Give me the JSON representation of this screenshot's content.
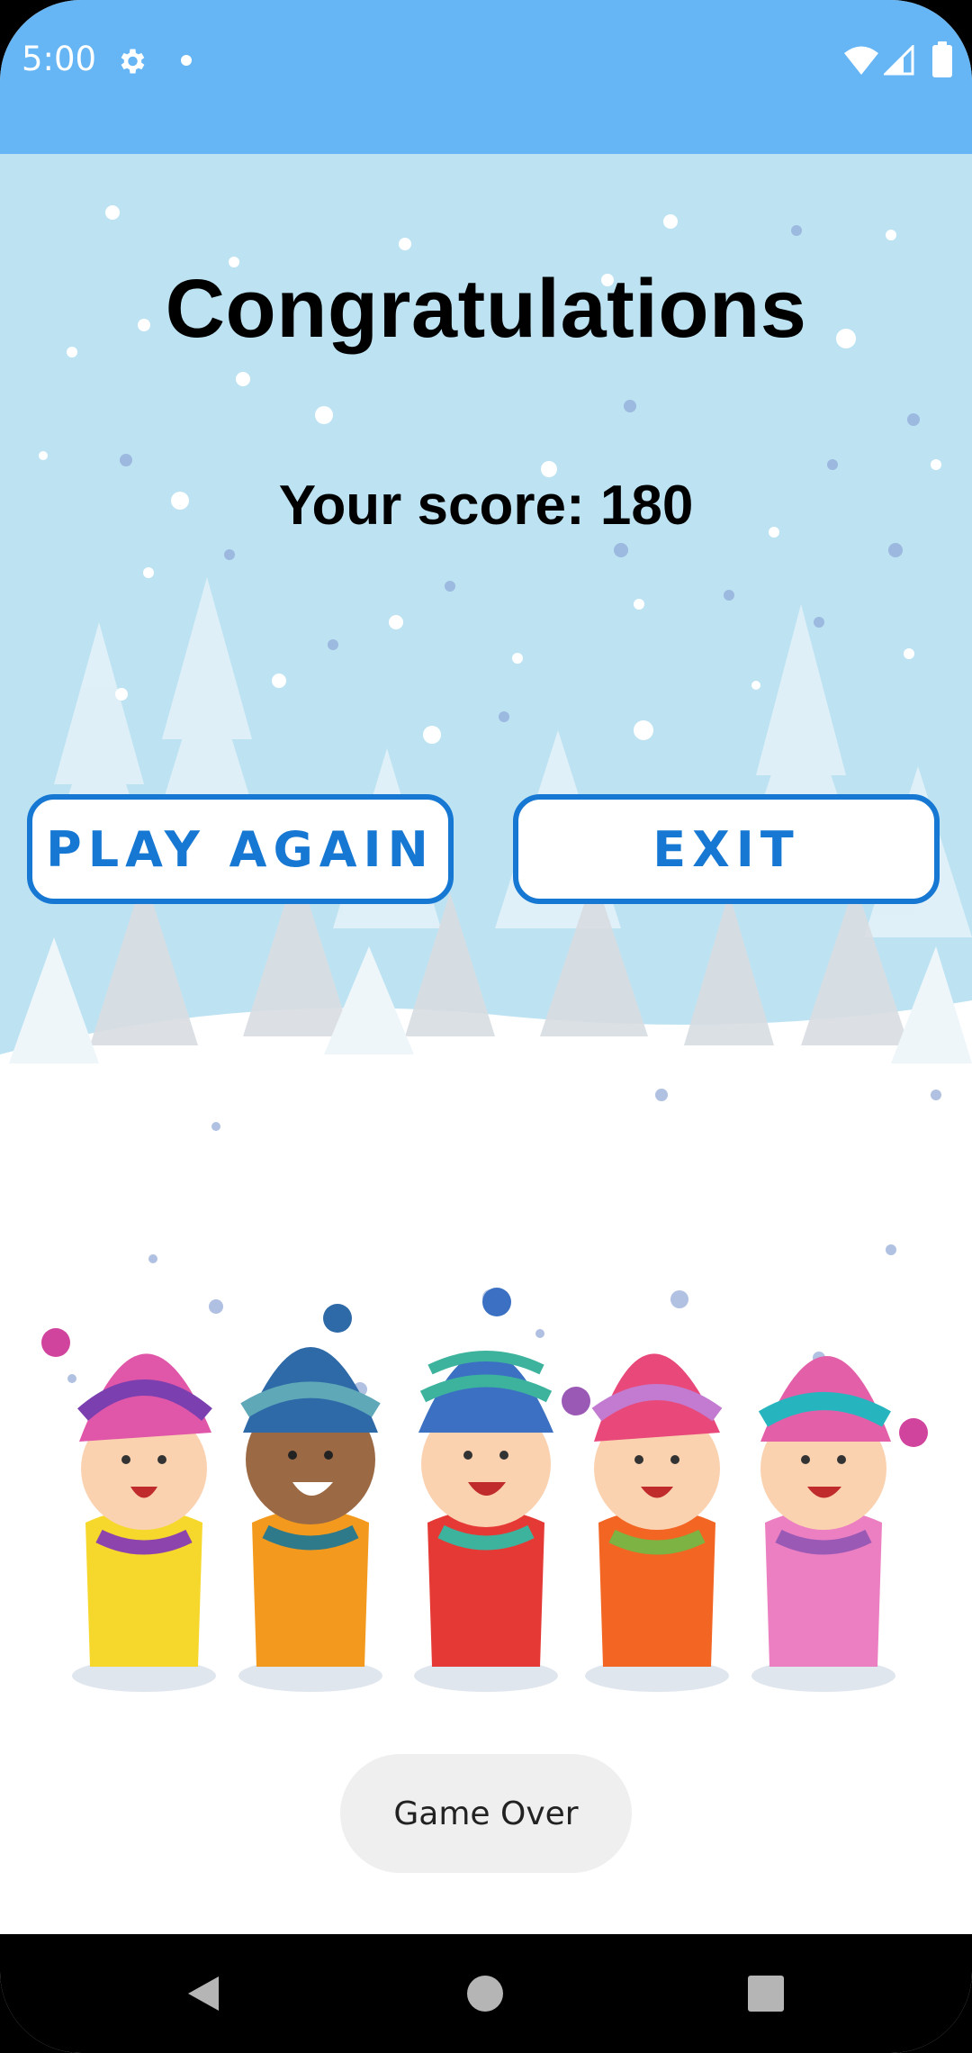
{
  "status_bar": {
    "time": "5:00",
    "icons": [
      "gear-icon",
      "notification-dot-icon",
      "wifi-icon",
      "signal-icon",
      "battery-icon"
    ]
  },
  "game": {
    "title": "Congratulations",
    "score_text": "Your score: 180",
    "buttons": {
      "play_again": "PLAY AGAIN",
      "exit": "EXIT"
    },
    "toast": "Game Over"
  },
  "nav_bar": {
    "icons": [
      "back-icon",
      "home-icon",
      "recents-icon"
    ]
  },
  "colors": {
    "status_bar": "#66b5f5",
    "sky": "#bde3f3",
    "button_accent": "#1678d2",
    "toast_bg": "#efefef"
  }
}
